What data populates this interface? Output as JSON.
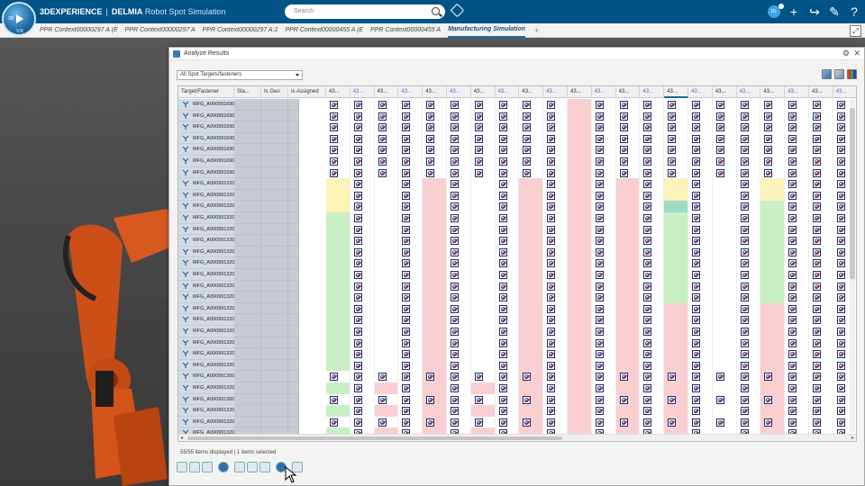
{
  "app": {
    "brand": "3DEXPERIENCE",
    "product": "DELMIA",
    "module": "Robot Spot Simulation",
    "compass_label": "3D",
    "compass_sub": "V,R"
  },
  "search": {
    "placeholder": "Search"
  },
  "user": {
    "initials": "DL"
  },
  "tabs": [
    {
      "label": "PPR Context00000297 A (E"
    },
    {
      "label": "PPR Context00000297 A"
    },
    {
      "label": "PPR Context00000297 A:2"
    },
    {
      "label": "PPR Context00000455 A (E"
    },
    {
      "label": "PPR Context00000455 A"
    },
    {
      "label": "Manufacturing Simulation",
      "active": true
    }
  ],
  "dialog": {
    "title": "Analyze Results",
    "filter_value": "All Spot Targets/fasteners",
    "status": "55/55 items displayed | 1 items selected",
    "columns": [
      "Target/Fastener",
      "Sta...",
      "Is Geo",
      "Is Assigned"
    ],
    "result_columns": [
      "43...",
      "43...",
      "43...",
      "43...",
      "43...",
      "43...",
      "43...",
      "43...",
      "43...",
      "43...",
      "43...",
      "43...",
      "43...",
      "43...",
      "43...",
      "43...",
      "43...",
      "43...",
      "43...",
      "43...",
      "43...",
      "43...",
      "43..."
    ],
    "result_column_tint": [
      "black",
      "purple",
      "black",
      "purple",
      "black",
      "purple",
      "black",
      "purple",
      "black",
      "purple",
      "black",
      "purple",
      "black",
      "purple",
      "black",
      "purple",
      "black",
      "purple",
      "black",
      "purple",
      "black",
      "purple",
      "black"
    ],
    "rows": [
      "MFG_A0009916903",
      "MFG_A0009916903",
      "MFG_A0009916903",
      "MFG_A0009916903",
      "MFG_A0009916903",
      "MFG_A0009916903",
      "MFG_A0009916903",
      "MFG_A0009913203",
      "MFG_A0009913203",
      "MFG_A0009913203",
      "MFG_A0009913203",
      "MFG_A0009913203",
      "MFG_A0009913203",
      "MFG_A0009913203",
      "MFG_A0009913203",
      "MFG_A0009913203",
      "MFG_A0009913203",
      "MFG_A0009913203",
      "MFG_A0009913203",
      "MFG_A0009913203",
      "MFG_A0009913203",
      "MFG_A0009913203",
      "MFG_A0009913203",
      "MFG_A0009913203",
      "MFG_A0009913003",
      "MFG_A0009913203",
      "MFG_A0009913003",
      "MFG_A0009913203",
      "MFG_A0009913203",
      "MFG_A0009913203",
      "MFG_A0009913003"
    ],
    "colors": {
      "red": "#f9cfd1",
      "green": "#c9f0c4",
      "yellow": "#fbf3b8",
      "teal": "#9fdcc4"
    }
  }
}
